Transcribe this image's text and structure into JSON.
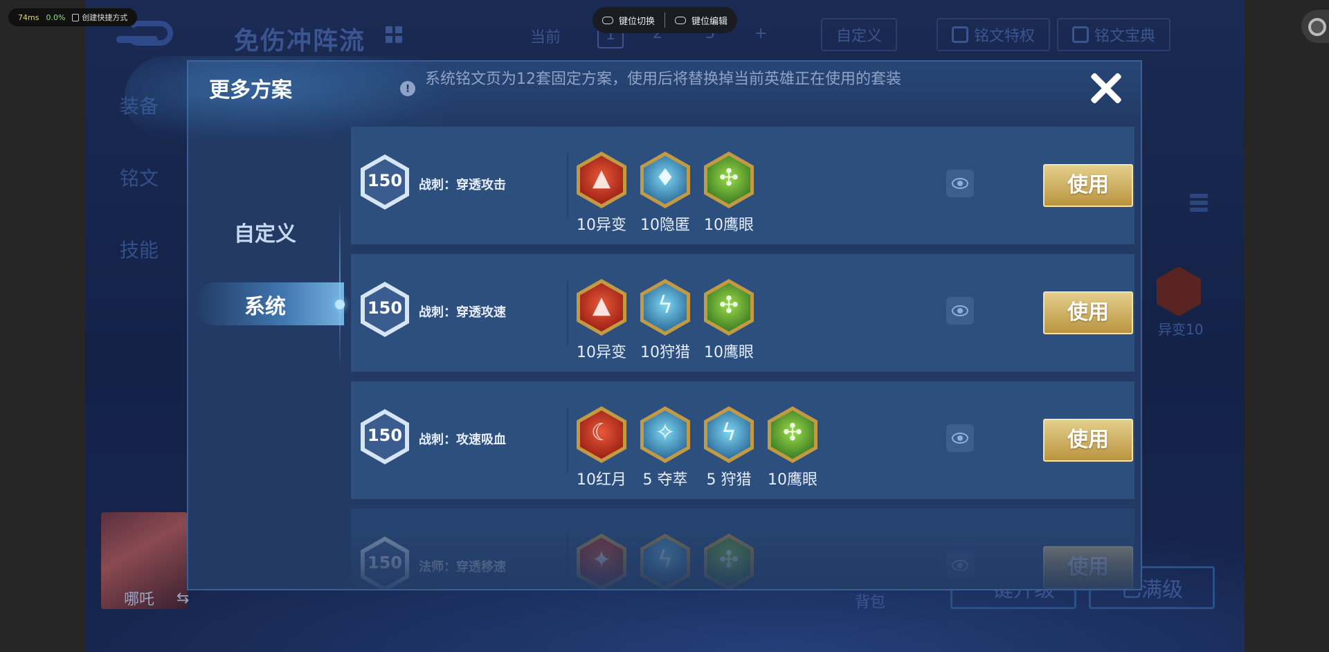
{
  "overlay": {
    "latency": "74ms",
    "loss": "0.0%",
    "shortcut_label": "创建快捷方式",
    "key_switch": "键位切换",
    "key_edit": "键位编辑"
  },
  "game_bg": {
    "title": "免伤冲阵流",
    "tab_current": "当前",
    "pages": [
      "1",
      "2",
      "3"
    ],
    "add": "+",
    "custom_btn": "自定义",
    "privilege_btn": "铭文特权",
    "guide_btn": "铭文宝典",
    "nav": [
      "装备",
      "铭文",
      "技能"
    ],
    "right_rune_label": "异变10",
    "hero_name": "哪吒",
    "swap": "⇆",
    "bag": "背包",
    "upgrade_btn": "一键升级",
    "maxed_btn": "已满级"
  },
  "dialog": {
    "title": "更多方案",
    "notice_icon": "!",
    "notice": "系统铭文页为12套固定方案，使用后将替换掉当前英雄正在使用的套装",
    "tabs": {
      "custom": "自定义",
      "system": "系统"
    },
    "use_label": "使用",
    "schemes": [
      {
        "level": "150",
        "name": "战刺：穿透攻击",
        "runes": [
          {
            "label": "10异变",
            "color": "red",
            "symbol": "▲"
          },
          {
            "label": "10隐匿",
            "color": "blue",
            "symbol": "♦"
          },
          {
            "label": "10鹰眼",
            "color": "green",
            "symbol": "✣"
          }
        ]
      },
      {
        "level": "150",
        "name": "战刺：穿透攻速",
        "runes": [
          {
            "label": "10异变",
            "color": "red",
            "symbol": "▲"
          },
          {
            "label": "10狩猎",
            "color": "blue",
            "symbol": "ϟ"
          },
          {
            "label": "10鹰眼",
            "color": "green",
            "symbol": "✣"
          }
        ]
      },
      {
        "level": "150",
        "name": "战刺：攻速吸血",
        "runes": [
          {
            "label": "10红月",
            "color": "red",
            "symbol": "☾"
          },
          {
            "label": "5 夺萃",
            "color": "blue",
            "symbol": "✧"
          },
          {
            "label": "5 狩猎",
            "color": "blue",
            "symbol": "ϟ"
          },
          {
            "label": "10鹰眼",
            "color": "green",
            "symbol": "✣"
          }
        ]
      },
      {
        "level": "150",
        "name": "法师：穿透移速",
        "runes": [
          {
            "label": "",
            "color": "red",
            "symbol": "✦"
          },
          {
            "label": "",
            "color": "blue",
            "symbol": "ϟ"
          },
          {
            "label": "",
            "color": "green",
            "symbol": "✣"
          }
        ]
      }
    ]
  }
}
